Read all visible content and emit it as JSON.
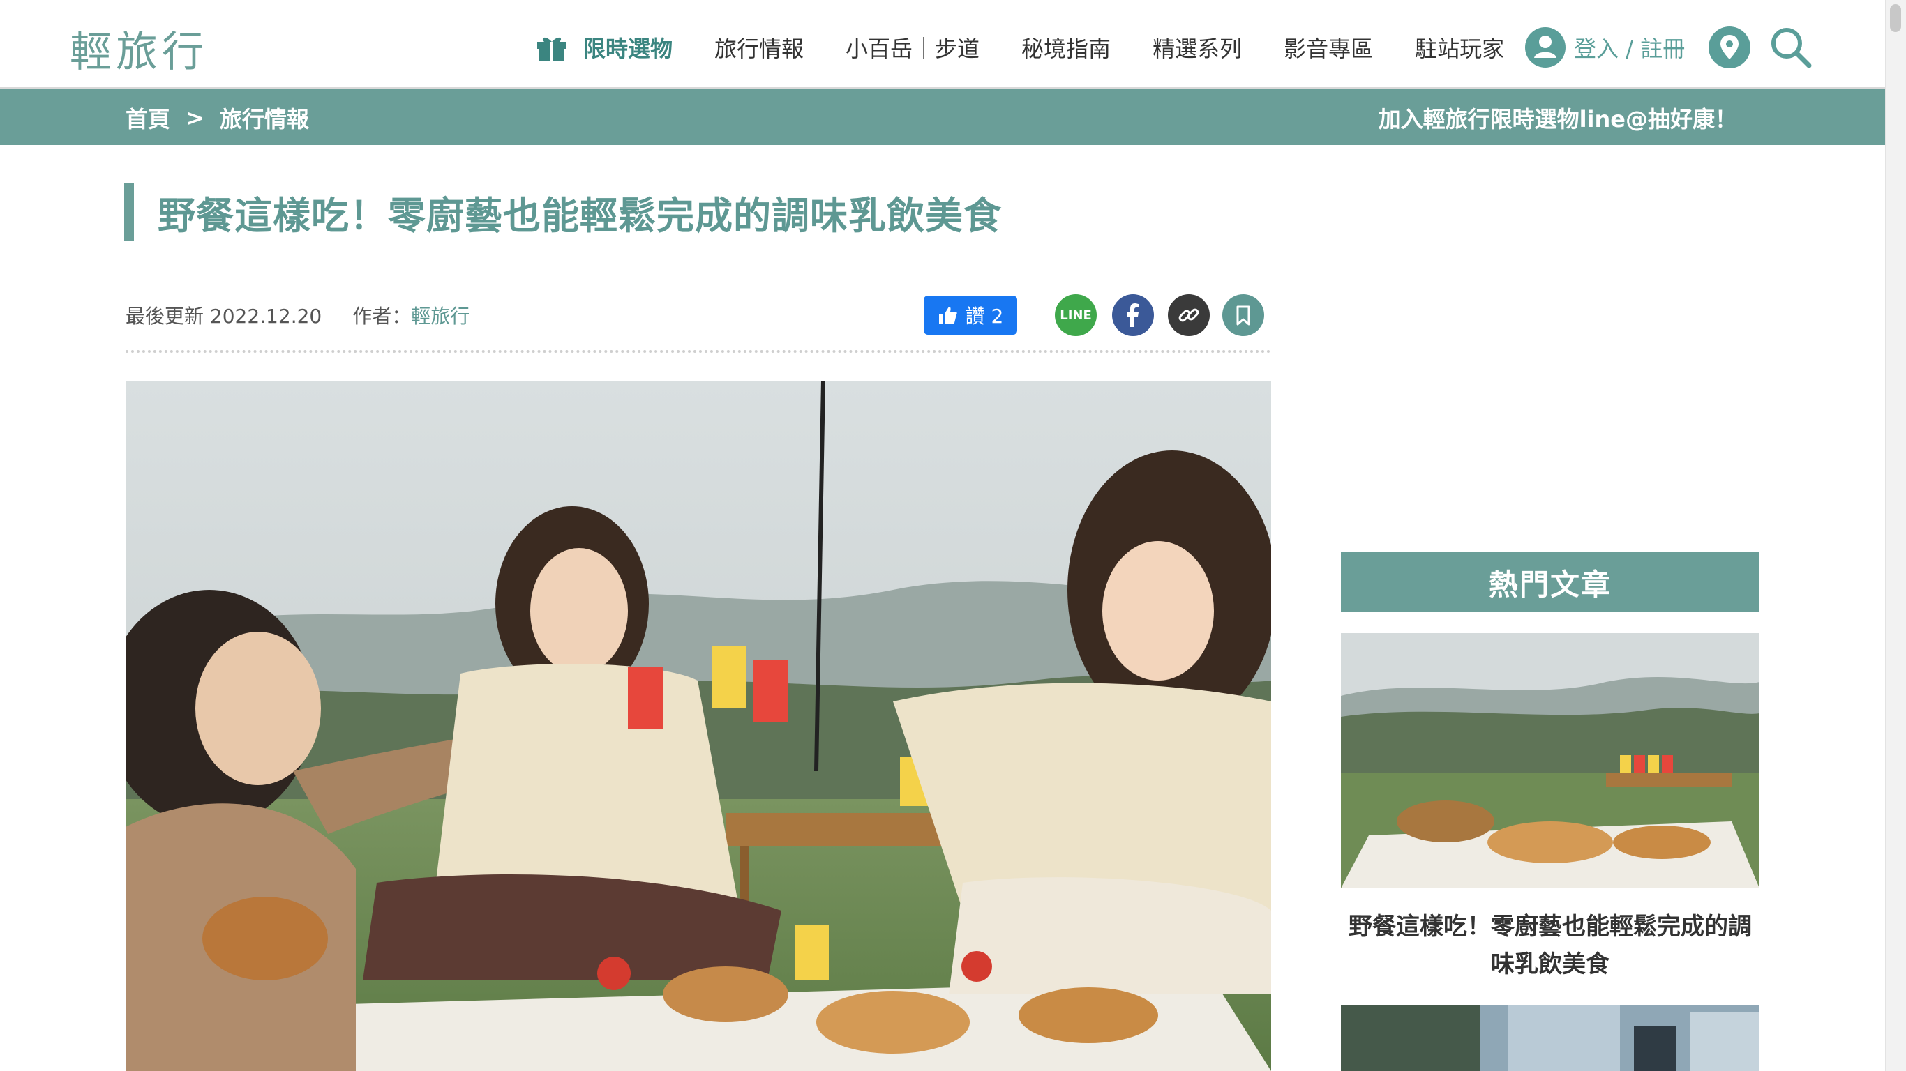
{
  "header": {
    "logo": "輕旅行",
    "nav": [
      {
        "label": "限時選物",
        "active": true
      },
      {
        "label": "旅行情報"
      },
      {
        "label": "小百岳｜步道"
      },
      {
        "label": "秘境指南"
      },
      {
        "label": "精選系列"
      },
      {
        "label": "影音專區"
      },
      {
        "label": "駐站玩家"
      }
    ],
    "login_label": "登入 / 註冊"
  },
  "crumbbar": {
    "breadcrumb": [
      "首頁",
      "旅行情報"
    ],
    "separator": ">",
    "promo": "加入輕旅行限時選物line@抽好康！"
  },
  "article": {
    "title": "野餐這樣吃！零廚藝也能輕鬆完成的調味乳飲美食",
    "updated_label": "最後更新 2022.12.20",
    "author_prefix": "作者：",
    "author": "輕旅行",
    "like_label": "讚 2",
    "line_label": "LINE"
  },
  "sidebar": {
    "hot_title": "熱門文章",
    "articles": [
      {
        "title": "野餐這樣吃！零廚藝也能輕鬆完成的調味乳飲美食"
      }
    ]
  },
  "colors": {
    "brand": "#6a9e98",
    "facebook": "#1877f2",
    "line": "#3fa84b"
  },
  "icons": [
    "gift-icon",
    "user-icon",
    "map-pin-icon",
    "search-icon",
    "thumbs-up-icon",
    "facebook-icon",
    "link-icon",
    "bookmark-icon"
  ]
}
